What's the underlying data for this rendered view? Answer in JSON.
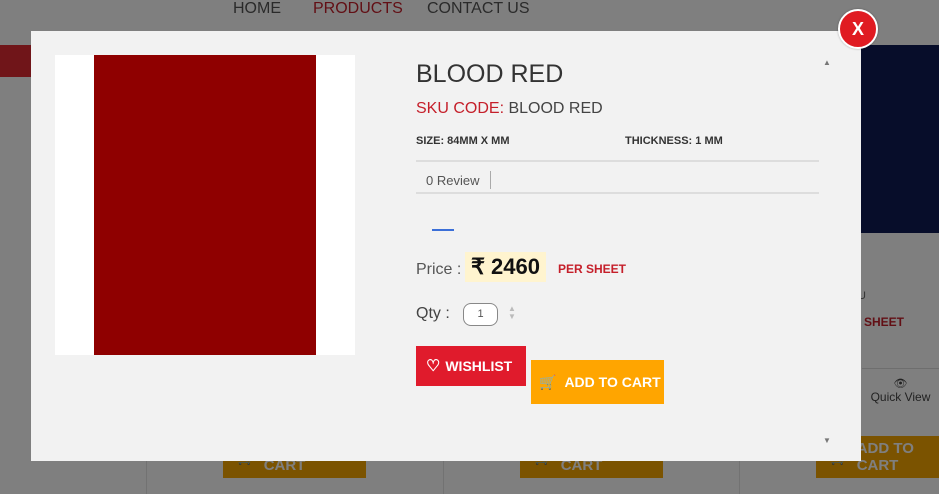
{
  "nav": {
    "home": "HOME",
    "products": "PRODUCTS",
    "contact": "CONTACT US"
  },
  "background": {
    "sku_fragment": "U",
    "per_sheet": "SHEET",
    "quick_view": "Quick View",
    "add_to_cart": "ADD TO CART"
  },
  "modal": {
    "close_label": "X",
    "title": "BLOOD RED",
    "sku_label": "SKU CODE:",
    "sku_value": "BLOOD RED",
    "size": "SIZE: 84MM X MM",
    "thickness": "THICKNESS: 1 MM",
    "reviews": "0 Review",
    "price_label": "Price :",
    "currency": "₹",
    "price": "2460",
    "per_unit": "PER SHEET",
    "qty_label": "Qty :",
    "qty_value": "1",
    "wishlist_label": "WISHLIST",
    "add_to_cart_label": "ADD TO CART"
  },
  "colors": {
    "accent_red": "#e01b22",
    "cart_orange": "#ffa500",
    "swatch": "#8f0000"
  },
  "icons": [
    "close-icon",
    "heart-icon",
    "cart-icon",
    "eye-icon",
    "scroll-up-icon",
    "scroll-down-icon"
  ]
}
